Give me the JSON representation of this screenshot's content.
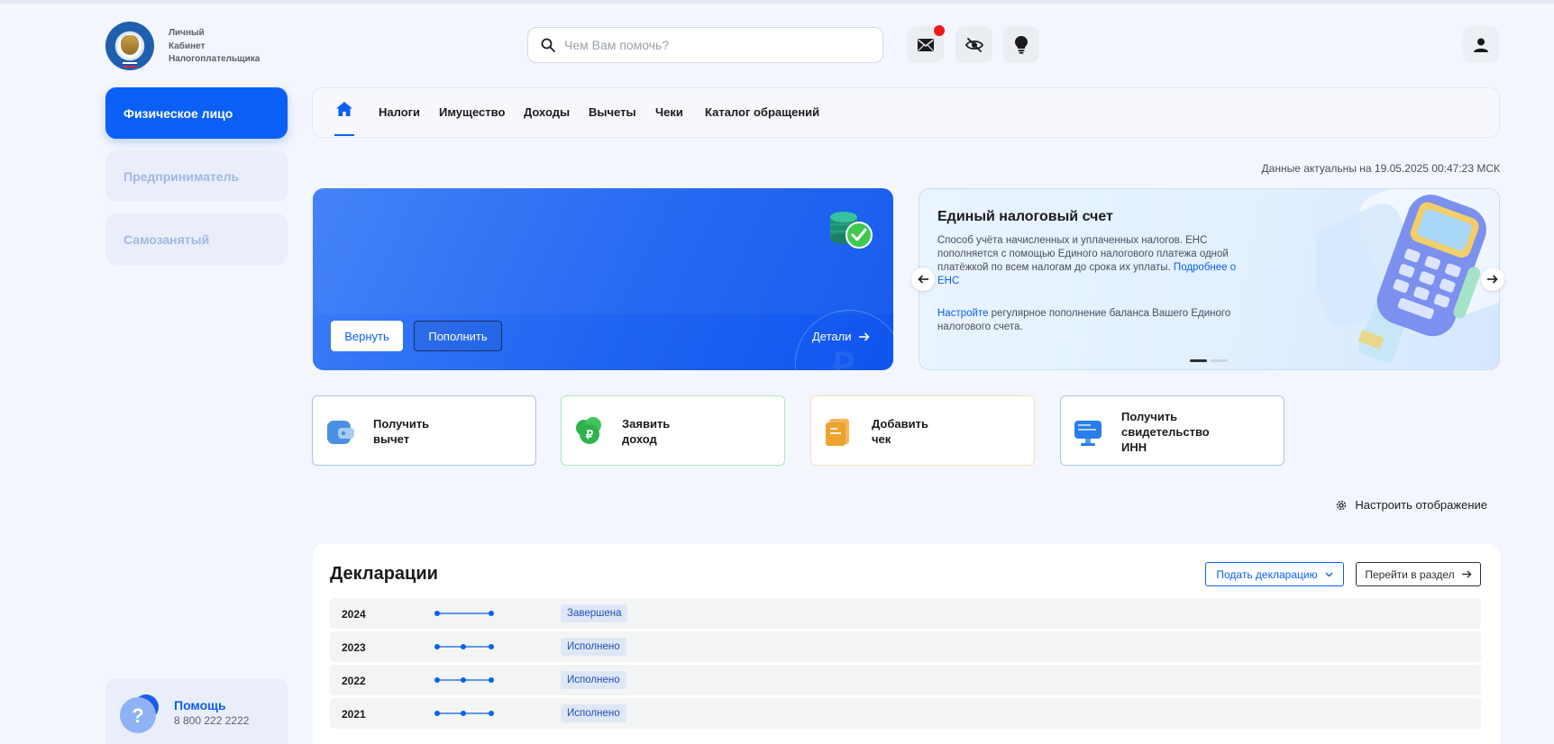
{
  "header": {
    "logo_lines": [
      "Личный",
      "Кабинет",
      "Налогоплательщика"
    ],
    "search_placeholder": "Чем Вам помочь?",
    "icons": [
      "mail-icon",
      "eye-off-icon",
      "lightbulb-icon",
      "user-icon"
    ],
    "has_notification": true
  },
  "sidebar": {
    "items": [
      {
        "label": "Физическое лицо",
        "active": true
      },
      {
        "label": "Предприниматель",
        "active": false
      },
      {
        "label": "Самозанятый",
        "active": false
      }
    ],
    "help": {
      "title": "Помощь",
      "phone": "8 800 222 2222"
    }
  },
  "nav": {
    "items": [
      "Налоги",
      "Имущество",
      "Доходы",
      "Вычеты",
      "Чеки",
      "Каталог обращений"
    ]
  },
  "actual_text": "Данные актуальны на 19.05.2025 00:47:23 МСК",
  "ens_card": {
    "return_label": "Вернуть",
    "topup_label": "Пополнить",
    "details_label": "Детали"
  },
  "promo": {
    "title": "Единый налоговый счет",
    "text_before_link": "Способ учёта начисленных и уплаченных налогов. ЕНС пополняется с помощью Единого налогового платежа одной платёжкой по всем налогам до срока их уплаты. ",
    "text_link": "Подробнее о ЕНС",
    "setup_link": "Настройте",
    "setup_text": " регулярное пополнение баланса Вашего Единого налогового счета.",
    "slide_index": 1,
    "slide_count": 2
  },
  "quick_actions": [
    {
      "line1": "Получить",
      "line2": "вычет",
      "line3": "",
      "color": "#4a90e2"
    },
    {
      "line1": "Заявить",
      "line2": "доход",
      "line3": "",
      "color": "#2fb24c"
    },
    {
      "line1": "Добавить",
      "line2": "чек",
      "line3": "",
      "color": "#f0a22e"
    },
    {
      "line1": "Получить",
      "line2": "свидетельство",
      "line3": "ИНН",
      "color": "#2b7de9"
    }
  ],
  "configure_label": "Настроить отображение",
  "declarations": {
    "title": "Декларации",
    "submit_label": "Подать декларацию",
    "go_label": "Перейти в раздел",
    "rows": [
      {
        "year": "2024",
        "status": "Завершена",
        "progress_steps": 2
      },
      {
        "year": "2023",
        "status": "Исполнено",
        "progress_steps": 3
      },
      {
        "year": "2022",
        "status": "Исполнено",
        "progress_steps": 3
      },
      {
        "year": "2021",
        "status": "Исполнено",
        "progress_steps": 3
      }
    ]
  }
}
